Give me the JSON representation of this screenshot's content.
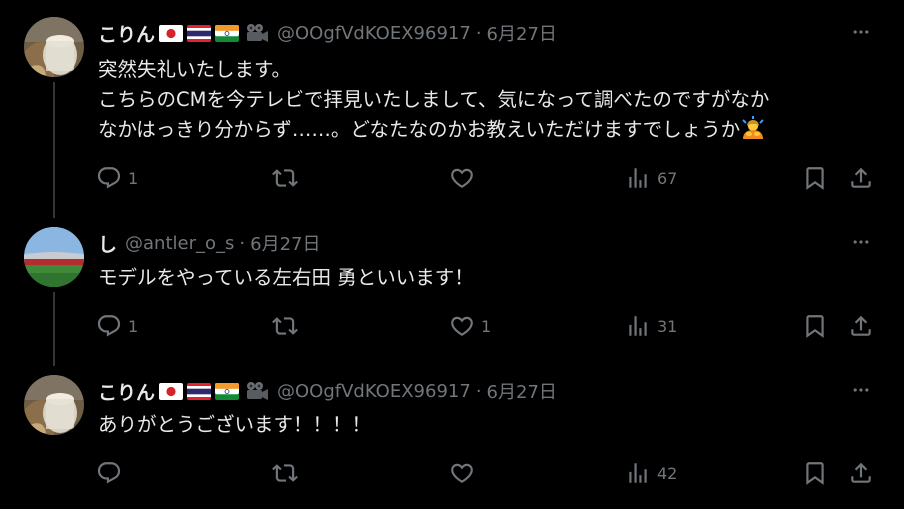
{
  "tweets": [
    {
      "name": "こりん",
      "handle": "@OOgfVdKOEX96917",
      "separator": "·",
      "date": "6月27日",
      "lines": [
        "突然失礼いたします。",
        "こちらのCMを今テレビで拝見いたしまして、気になって調べたのですがなか",
        "なかはっきり分からず……。どなたなのかお教えいただけますでしょうか"
      ],
      "reply_count": "1",
      "retweet_count": "",
      "like_count": "",
      "view_count": "67"
    },
    {
      "name": "し",
      "handle": "@antler_o_s",
      "separator": "·",
      "date": "6月27日",
      "lines": [
        "モデルをやっている左右田 勇といいます！"
      ],
      "reply_count": "1",
      "retweet_count": "",
      "like_count": "1",
      "view_count": "31"
    },
    {
      "name": "こりん",
      "handle": "@OOgfVdKOEX96917",
      "separator": "·",
      "date": "6月27日",
      "lines": [
        "ありがとうございます！！！！"
      ],
      "reply_count": "",
      "retweet_count": "",
      "like_count": "",
      "view_count": "42"
    }
  ],
  "colors": {
    "background": "#000000",
    "text": "#e7e9ea",
    "muted": "#71767b",
    "thread_line": "#333639"
  },
  "icons": [
    "reply-icon",
    "retweet-icon",
    "like-icon",
    "views-icon",
    "bookmark-icon",
    "share-icon",
    "more-icon",
    "japan-flag-icon",
    "thailand-flag-icon",
    "india-flag-icon",
    "movie-camera-icon",
    "bowing-person-emoji"
  ]
}
